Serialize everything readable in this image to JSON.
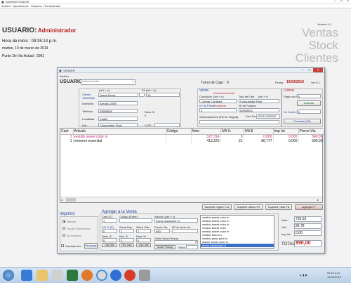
{
  "outer": {
    "title": "ADMINISTRADOR",
    "menu": [
      "Archivo",
      "Operaciones",
      "Usuarios",
      "Herramientas"
    ],
    "version": "Versión 9.1",
    "user_label": "USUARIO:",
    "user_name": "Administrador",
    "start_time": "Hora de inicio : 09:35:14 p.m.",
    "date_line": "martes, 19 de marzo de 2019",
    "sale_point": "Punto De Vta Actual : 0001",
    "watermark": [
      "Ventas",
      "Stock",
      "Clientes"
    ]
  },
  "dialog": {
    "title": "VENDER",
    "menu": "Archivo",
    "usuario_label": "USUARIO",
    "usuario_value": "Administrador",
    "turno_label": "Turno de Caja :",
    "turno_value": "0",
    "fecha_label": "Fecha:",
    "fecha_value": "19/03/2019",
    "version": "Ver 9.1",
    "client": {
      "cliente_label": "Cliente",
      "cliente_code": "10001198",
      "enter_hint1": "(ctrl + n)",
      "enter_hint2": "F5 (ctrl + b)",
      "nombre": "Juana Perez",
      "id": "10",
      "domicilio_label": "Domicilio",
      "domicilio": "Arevalo 2008",
      "telefono_label": "Teléfono",
      "telefono": "45555555",
      "desc_label": "Desc. $",
      "desc_value": "0",
      "localidad_label": "Localidad",
      "localidad": "CABA",
      "iva_label": "IVA :",
      "iva_value": "Consumidor Final",
      "cuit_label": "CUIT :",
      "cuit_value": ""
    },
    "venta": {
      "section": "Venta",
      "cuenta_label": "Cuenta Corriente",
      "condicion_label": "Condición",
      "condicion_hint": "(ctrl + c)",
      "tipo_label": "Tipo de Fact.",
      "tipo_hint": "(ctrl + t)",
      "condicion_value": "Cuenta Corriente",
      "tipo_value": "Consumidor Final",
      "presu_label": "Nº de Presu.",
      "presu_value": "Pendiente",
      "fact_label": "Nº de Factura",
      "presu_num": "0",
      "fact_num": "00000002",
      "obs_label": "Observaciones (Pie de Página)",
      "fact_cae_label": "Fact. Cte.",
      "fact_cae_value": "00025-00000000"
    },
    "cobrar": {
      "section": "Cobrar",
      "pago_label": "Pago con $",
      "pago_value": "0",
      "calcular": "Calcular",
      "vuelto_label": "Su Vuelto $",
      "vuelto_value": "0",
      "procesar": "Procesar (F5)"
    },
    "grid": {
      "headers": [
        "Cant",
        "Articulo",
        "Código",
        "Neto",
        "IVA %",
        "IVA $",
        "Imp Int",
        "Precio Vta"
      ],
      "rows": [
        {
          "cant": "1",
          "articulo": "vestido sweet color m",
          "codigo": "",
          "neto": "327,314",
          "iva_pct": "0",
          "iva_amt": "0,000",
          "imp_int": "0,000",
          "precio": "340,00"
        },
        {
          "cant": "1",
          "articulo": "remeron essential",
          "codigo": "",
          "neto": "413,220",
          "iva_pct": "21",
          "iva_amt": "86,777",
          "imp_int": "0,000",
          "precio": "500,00"
        }
      ]
    },
    "bottom_buttons": [
      "Suprimir reglón F12",
      "Suprimir último F9",
      "Suprimir Todo F8",
      "Agregar F7"
    ],
    "imprimir": {
      "section": "Imprimir",
      "opts": [
        "Normal",
        "Fiscal / Electrónica",
        "No Imprimir"
      ],
      "cambiar": "Cambiar Nro",
      "procesar": "Procesar"
    },
    "agregar": {
      "section": "Agregar a la Venta",
      "cant_label": "Cant (C)",
      "codigo_label": "Código (Enter)",
      "articulo_label": "Artículo (ctrl + v)",
      "cant_value": "1",
      "articulo_value": "mono vavavoom m",
      "iva_label": "IVA % (P)",
      "stock_dep_label": "Stock Dep.",
      "stock_cab_label": "Stock Cab.",
      "precio_vta_label": "Precio Vta",
      "serie_label": "Nº de serie s/u",
      "iva_value": "0",
      "stock_dep_value": "1",
      "stock_cab_value": "1",
      "precio_vta_value": "890",
      "desc1_label": "Desc. $",
      "rec1_label": "Rec. $",
      "desc2_label": "Desc %",
      "desc1_value": "0",
      "rec1_value": "0",
      "desc2_value": "0",
      "calc1": "Calc Sell",
      "calc2": "Rec Calc",
      "calc3": "Calc Sell",
      "vend_label": "Selec Vend Presup",
      "anot_label": "Anot Presup",
      "seña_label": "Seña 1"
    },
    "suggest": [
      "vestido sweet color m",
      "vestido sweet color m",
      "vestido sweet color m",
      "vestido sweet color",
      "vestido sweet color m",
      "vestido bueno s",
      "vestido pearl print m",
      "ilusion sweet color m",
      "mono vavavoom m"
    ],
    "totals": {
      "neto_label": "Neto :",
      "neto_value": "735,53",
      "iva_label": "IVA :",
      "iva_value": "86,78",
      "impint_label": "Imp Int:",
      "impint_value": "0,00",
      "total_label": "TOTAL:",
      "total_value": "890,00"
    }
  },
  "taskbar": {
    "time": "09:25 p.m.",
    "date": "19/03/2019"
  },
  "colors": {
    "accent_red": "#b41e1e",
    "label_blue": "#1f3fa0",
    "selection_pink": "#c0207a"
  }
}
